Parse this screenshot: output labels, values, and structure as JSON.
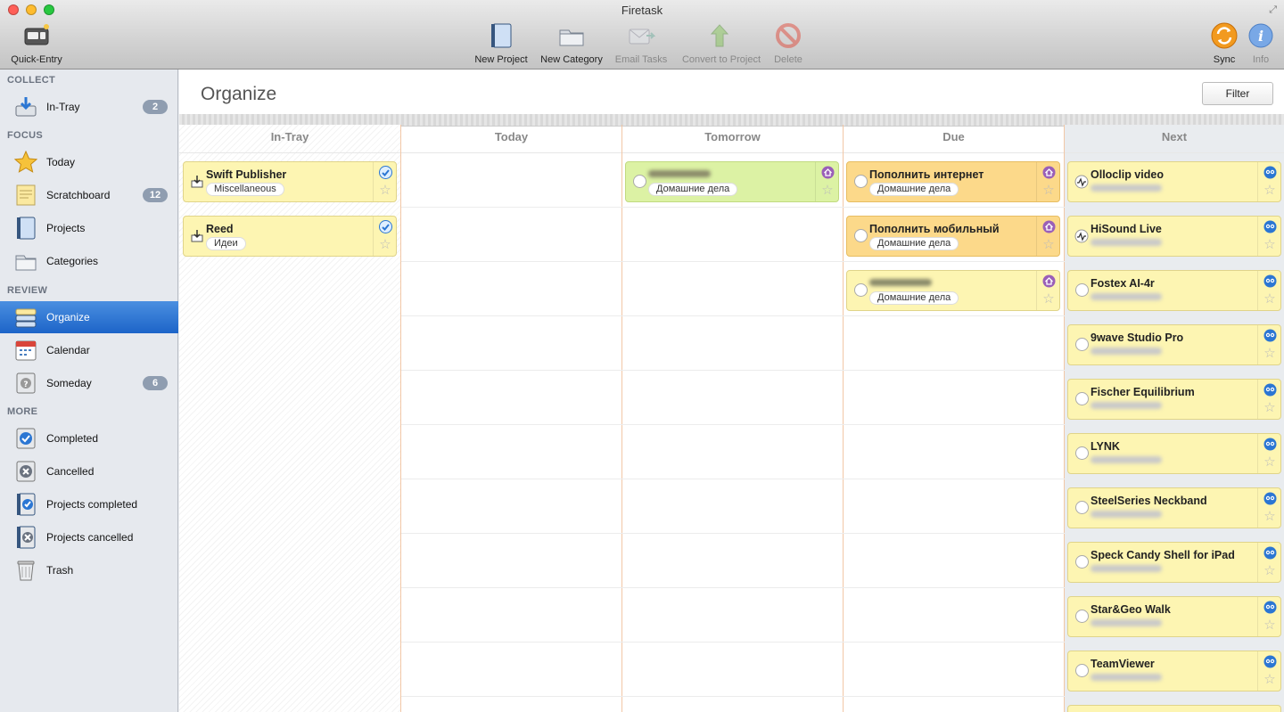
{
  "window": {
    "title": "Firetask"
  },
  "toolbar": {
    "quick_entry": "Quick-Entry",
    "new_project": "New Project",
    "new_category": "New Category",
    "email_tasks": "Email Tasks",
    "convert_to_project": "Convert to Project",
    "delete": "Delete",
    "sync": "Sync",
    "info": "Info"
  },
  "sidebar": {
    "collect": "COLLECT",
    "focus": "FOCUS",
    "review": "REVIEW",
    "more": "MORE",
    "items": [
      {
        "label": "In-Tray",
        "badge": "2"
      },
      {
        "label": "Today"
      },
      {
        "label": "Scratchboard",
        "badge": "12"
      },
      {
        "label": "Projects"
      },
      {
        "label": "Categories"
      },
      {
        "label": "Organize"
      },
      {
        "label": "Calendar"
      },
      {
        "label": "Someday",
        "badge": "6"
      },
      {
        "label": "Completed"
      },
      {
        "label": "Cancelled"
      },
      {
        "label": "Projects completed"
      },
      {
        "label": "Projects cancelled"
      },
      {
        "label": "Trash"
      }
    ]
  },
  "main": {
    "title": "Organize",
    "filter": "Filter",
    "columns": [
      "In-Tray",
      "Today",
      "Tomorrow",
      "Due",
      "Next"
    ]
  },
  "cards": {
    "intray": [
      {
        "name": "Swift Publisher",
        "tag": "Miscellaneous"
      },
      {
        "name": "Reed",
        "tag": "Идеи"
      }
    ],
    "tomorrow": [
      {
        "tag": "Домашние дела"
      }
    ],
    "due": [
      {
        "name": "Пополнить интернет",
        "tag": "Домашние дела"
      },
      {
        "name": "Пополнить мобильный",
        "tag": "Домашние дела"
      },
      {
        "tag": "Домашние дела"
      }
    ],
    "next": [
      {
        "name": "Olloclip video"
      },
      {
        "name": "HiSound Live"
      },
      {
        "name": "Fostex AI-4r"
      },
      {
        "name": "9wave Studio Pro"
      },
      {
        "name": "Fischer Equilibrium"
      },
      {
        "name": "LYNK"
      },
      {
        "name": "SteelSeries Neckband"
      },
      {
        "name": "Speck Candy Shell for iPad"
      },
      {
        "name": "Star&Geo Walk"
      },
      {
        "name": "TeamViewer"
      }
    ]
  }
}
